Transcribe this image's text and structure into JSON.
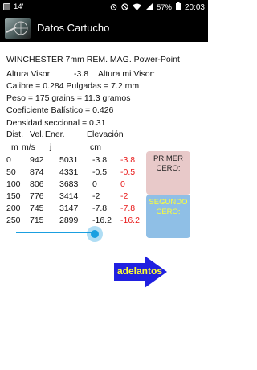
{
  "status_bar": {
    "notification_text": "14'",
    "battery_percent": "57%",
    "time": "20:03"
  },
  "app_bar": {
    "title": "Datos Cartucho"
  },
  "cartridge": {
    "name": "WINCHESTER 7mm REM. MAG. Power-Point",
    "altura_visor_label": "Altura Visor",
    "altura_visor_value": "-3.8",
    "altura_mi_visor_label": "Altura mi Visor:",
    "calibre": "Calibre = 0.284 Pulgadas = 7.2 mm",
    "peso": "Peso = 175 grains = 11.3 gramos",
    "coeficiente": "Coeficiente Balístico = 0.426",
    "densidad": "Densidad seccional = 0.31"
  },
  "table": {
    "header1": {
      "dist": "Dist.",
      "vel": "Vel.",
      "ener": "Ener.",
      "elev": "Elevación"
    },
    "header2": {
      "dist": "m",
      "vel": "m/s",
      "ener": "j",
      "elev": "cm"
    },
    "rows": [
      {
        "dist": "0",
        "vel": "942",
        "ener": "5031",
        "elev": "-3.8",
        "elev_red": "-3.8"
      },
      {
        "dist": "50",
        "vel": "874",
        "ener": "4331",
        "elev": "-0.5",
        "elev_red": "-0.5"
      },
      {
        "dist": "100",
        "vel": "806",
        "ener": "3683",
        "elev": "0",
        "elev_red": "0"
      },
      {
        "dist": "150",
        "vel": "776",
        "ener": "3414",
        "elev": "-2",
        "elev_red": "-2"
      },
      {
        "dist": "200",
        "vel": "745",
        "ener": "3147",
        "elev": "-7.8",
        "elev_red": "-7.8"
      },
      {
        "dist": "250",
        "vel": "715",
        "ener": "2899",
        "elev": "-16.2",
        "elev_red": "-16.2"
      }
    ]
  },
  "buttons": {
    "primer_cero": "PRIMER CERO:",
    "segundo_cero": "SEGUNDO CERO:",
    "next": "adelantos"
  },
  "slider": {
    "value_fraction": 0.9
  },
  "colors": {
    "accent": "#1a9fe0",
    "red_values": "#e81818",
    "primer_bg": "#e8c9c9",
    "segundo_bg": "#8fbfe6",
    "arrow": "#2020e0"
  }
}
